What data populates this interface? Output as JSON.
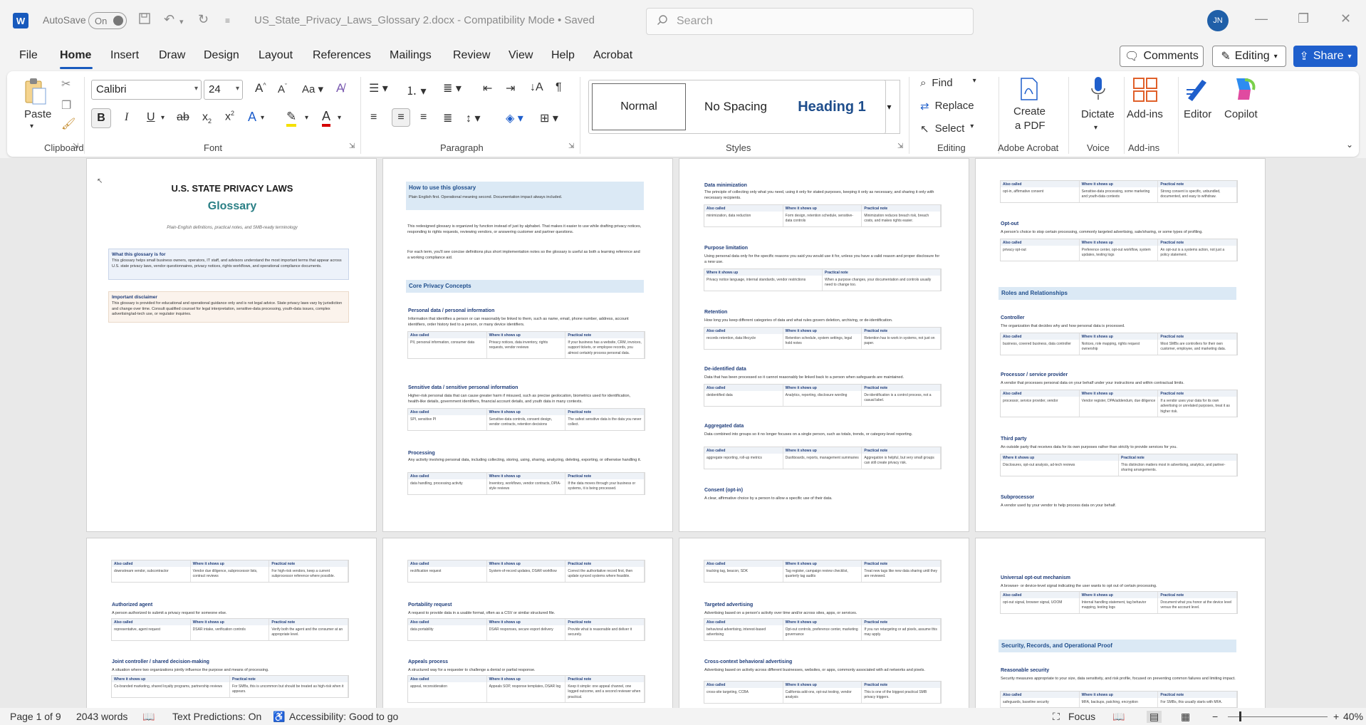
{
  "titlebar": {
    "autosave_label": "AutoSave",
    "autosave_state": "On",
    "doc_title": "US_State_Privacy_Laws_Glossary 2.docx  -  Compatibility Mode  •  Saved",
    "search_placeholder": "Search",
    "user_initials": "JN"
  },
  "menu": {
    "tabs": [
      "File",
      "Home",
      "Insert",
      "Draw",
      "Design",
      "Layout",
      "References",
      "Mailings",
      "Review",
      "View",
      "Help",
      "Acrobat"
    ],
    "active": "Home",
    "comments": "Comments",
    "editing": "Editing",
    "share": "Share"
  },
  "ribbon": {
    "clipboard": {
      "paste": "Paste",
      "label": "Clipboard"
    },
    "font": {
      "name": "Calibri",
      "size": "24",
      "label": "Font"
    },
    "paragraph": {
      "label": "Paragraph"
    },
    "styles": {
      "normal": "Normal",
      "no_spacing": "No Spacing",
      "heading1": "Heading 1",
      "label": "Styles"
    },
    "editing": {
      "find": "Find",
      "replace": "Replace",
      "select": "Select",
      "label": "Editing"
    },
    "acrobat": {
      "create_pdf_1": "Create",
      "create_pdf_2": "a PDF",
      "label": "Adobe Acrobat"
    },
    "voice": {
      "dictate": "Dictate",
      "label": "Voice"
    },
    "addins": {
      "addins": "Add-ins",
      "label": "Add-ins"
    },
    "editor": "Editor",
    "copilot": "Copilot"
  },
  "pages": {
    "p1": {
      "title": "U.S. STATE PRIVACY LAWS",
      "glossary": "Glossary",
      "subtitle": "Plain-English definitions, practical notes, and SMB-ready terminology",
      "box1_h": "What this glossary is for",
      "box1_t": "This glossary helps small business owners, operators, IT staff, and advisors understand the most important terms that appear across U.S. state privacy laws, vendor questionnaires, privacy notices, rights workflows, and operational compliance documents.",
      "box2_h": "Important disclaimer",
      "box2_t": "This glossary is provided for educational and operational guidance only and is not legal advice. State privacy laws vary by jurisdiction and change over time. Consult qualified counsel for legal interpretation, sensitive-data processing, youth-data issues, complex advertising/ad-tech use, or regulator inquiries."
    },
    "p2": {
      "band1": "How to use this glossary",
      "band1_t": "Plain English first. Operational meaning second. Documentation impact always included.",
      "para1": "This redesigned glossary is organized by function instead of just by alphabet. That makes it easier to use while drafting privacy notices, responding to rights requests, reviewing vendors, or answering customer and partner questions.",
      "para2": "For each term, you'll see concise definitions plus short implementation notes so the glossary is useful as both a learning reference and a working compliance aid.",
      "band2": "Core Privacy Concepts",
      "t1": "Personal data / personal information",
      "d1": "Information that identifies a person or can reasonably be linked to them, such as name, email, phone number, address, account identifiers, order history tied to a person, or many device identifiers.",
      "r1": [
        "PII, personal information, consumer data",
        "Privacy notices, data inventory, rights requests, vendor reviews",
        "If your business has a website, CRM, invoices, support tickets, or employee records, you almost certainly process personal data."
      ],
      "t2": "Sensitive data / sensitive personal information",
      "d2": "Higher-risk personal data that can cause greater harm if misused, such as precise geolocation, biometrics used for identification, health-like details, government identifiers, financial account details, and youth data in many contexts.",
      "r2": [
        "SPI, sensitive PI",
        "Sensitive-data controls, consent design, vendor contracts, retention decisions",
        "The safest sensitive data is the data you never collect."
      ],
      "t3": "Processing",
      "d3": "Any activity involving personal data, including collecting, storing, using, sharing, analyzing, deleting, exporting, or otherwise handling it.",
      "r3": [
        "data handling, processing activity",
        "Inventory, workflows, vendor contracts, DPIA-style reviews",
        "If the data moves through your business or systems, it is being processed."
      ]
    },
    "p3": {
      "t1": "Data minimization",
      "d1": "The principle of collecting only what you need, using it only for stated purposes, keeping it only as necessary, and sharing it only with necessary recipients.",
      "r1": [
        "minimization, data reduction",
        "Form design, retention schedule, sensitive-data controls",
        "Minimization reduces breach risk, breach costs, and makes rights easier."
      ],
      "t2": "Purpose limitation",
      "d2": "Using personal data only for the specific reasons you said you would use it for, unless you have a valid reason and proper disclosure for a new use.",
      "r2": [
        "Privacy notice language, internal standards, vendor restrictions",
        "When a purpose changes, your documentation and controls usually need to change too."
      ],
      "t3": "Retention",
      "d3": "How long you keep different categories of data and what rules govern deletion, archiving, or de-identification.",
      "r3": [
        "records retention, data lifecycle",
        "Retention schedule, system settings, legal hold notes",
        "Retention has to work in systems, not just on paper."
      ],
      "t4": "De-identified data",
      "d4": "Data that has been processed so it cannot reasonably be linked back to a person when safeguards are maintained.",
      "r4": [
        "deidentified data",
        "Analytics, reporting, disclosure wording",
        "De-identification is a control process, not a casual label."
      ],
      "t5": "Aggregated data",
      "d5": "Data combined into groups so it no longer focuses on a single person, such as totals, trends, or category-level reporting.",
      "r5": [
        "aggregate reporting, roll-up metrics",
        "Dashboards, reports, management summaries",
        "Aggregation is helpful, but very small groups can still create privacy risk."
      ],
      "t6": "Consent (opt-in)",
      "d6": "A clear, affirmative choice by a person to allow a specific use of their data."
    },
    "p4": {
      "r0": [
        "opt-in, affirmative consent",
        "Sensitive-data processing, some marketing and youth-data contexts",
        "Strong consent is specific, unbundled, documented, and easy to withdraw."
      ],
      "t1": "Opt-out",
      "d1": "A person's choice to stop certain processing, commonly targeted advertising, sale/sharing, or some types of profiling.",
      "r1": [
        "privacy opt-out",
        "Preference center, opt-out workflow, system updates, testing logs",
        "An opt-out is a systems action, not just a policy statement."
      ],
      "band": "Roles and Relationships",
      "t2": "Controller",
      "d2": "The organization that decides why and how personal data is processed.",
      "r2": [
        "business, covered business, data controller",
        "Notices, role mapping, rights request ownership",
        "Most SMBs are controllers for their own customer, employee, and marketing data."
      ],
      "t3": "Processor / service provider",
      "d3": "A vendor that processes personal data on your behalf under your instructions and within contractual limits.",
      "r3": [
        "processor, service provider, vendor",
        "Vendor register, DPA/addendum, due diligence",
        "If a vendor uses your data for its own advertising or unrelated purposes, treat it as higher risk."
      ],
      "t4": "Third party",
      "d4": "An outside party that receives data for its own purposes rather than strictly to provide services for you.",
      "r4": [
        "Disclosures, opt-out analysis, ad-tech reviews",
        "This distinction matters most in advertising, analytics, and partner-sharing arrangements."
      ],
      "t5": "Subprocessor",
      "d5": "A vendor used by your vendor to help process data on your behalf."
    },
    "p5": {
      "r0": [
        "downstream vendor, subcontractor",
        "Vendor due diligence, subprocessor lists, contract reviews",
        "For high-risk vendors, keep a current subprocessor reference where possible."
      ],
      "t1": "Authorized agent",
      "d1": "A person authorized to submit a privacy request for someone else.",
      "r1": [
        "representative, agent request",
        "DSAR intake, verification controls",
        "Verify both the agent and the consumer at an appropriate level."
      ],
      "t2": "Joint controller / shared decision-making",
      "d2": "A situation where two organizations jointly influence the purpose and means of processing.",
      "r2": [
        "Co-branded marketing, shared loyalty programs, partnership reviews",
        "For SMBs, this is uncommon but should be treated as high-risk when it appears."
      ]
    },
    "p6": {
      "r0": [
        "rectification request",
        "System-of-record updates, DSAR workflow",
        "Correct the authoritative record first, then update synced systems where feasible."
      ],
      "t1": "Portability request",
      "d1": "A request to provide data in a usable format, often as a CSV or similar structured file.",
      "r1": [
        "data portability",
        "DSAR responses, secure export delivery",
        "Provide what is reasonable and deliver it securely."
      ],
      "t2": "Appeals process",
      "d2": "A structured way for a requester to challenge a denial or partial response.",
      "r2": [
        "appeal, reconsideration",
        "Appeals SOP, response templates, DSAR log",
        "Keep it simple: one appeal channel, one logged outcome, and a second reviewer when practical."
      ]
    },
    "p7": {
      "r0": [
        "tracking tag, beacon, SDK",
        "Tag register, campaign review checklist, quarterly tag audits",
        "Treat new tags like new data sharing until they are reviewed."
      ],
      "t1": "Targeted advertising",
      "d1": "Advertising based on a person's activity over time and/or across sites, apps, or services.",
      "r1": [
        "behavioral advertising, interest-based advertising",
        "Opt-out controls, preference center, marketing governance",
        "If you run retargeting or ad pixels, assume this may apply."
      ],
      "t2": "Cross-context behavioral advertising",
      "d2": "Advertising based on activity across different businesses, websites, or apps, commonly associated with ad networks and pixels.",
      "r2": [
        "cross-site targeting, CCBA",
        "California add-ons, opt-out testing, vendor analysis",
        "This is one of the biggest practical SMB privacy triggers."
      ]
    },
    "p8": {
      "t1": "Universal opt-out mechanism",
      "d1": "A browser- or device-level signal indicating the user wants to opt out of certain processing.",
      "r1": [
        "opt-out signal, browser signal, UOOM",
        "Internal handling statement, tag behavior mapping, testing logs",
        "Document what you honor at the device level versus the account level."
      ],
      "band": "Security, Records, and Operational Proof",
      "t2": "Reasonable security",
      "d2": "Security measures appropriate to your size, data sensitivity, and risk profile, focused on preventing common failures and limiting impact.",
      "r2": [
        "safeguards, baseline security",
        "MFA, backups, patching, encryption",
        "For SMBs, this usually starts with MFA."
      ]
    },
    "table_headers": {
      "also": "Also called",
      "where": "Where it shows up",
      "note": "Practical note"
    }
  },
  "status": {
    "page": "Page 1 of 9",
    "words": "2043 words",
    "text_predictions": "Text Predictions: On",
    "accessibility": "Accessibility: Good to go",
    "focus": "Focus",
    "zoom": "40%"
  }
}
